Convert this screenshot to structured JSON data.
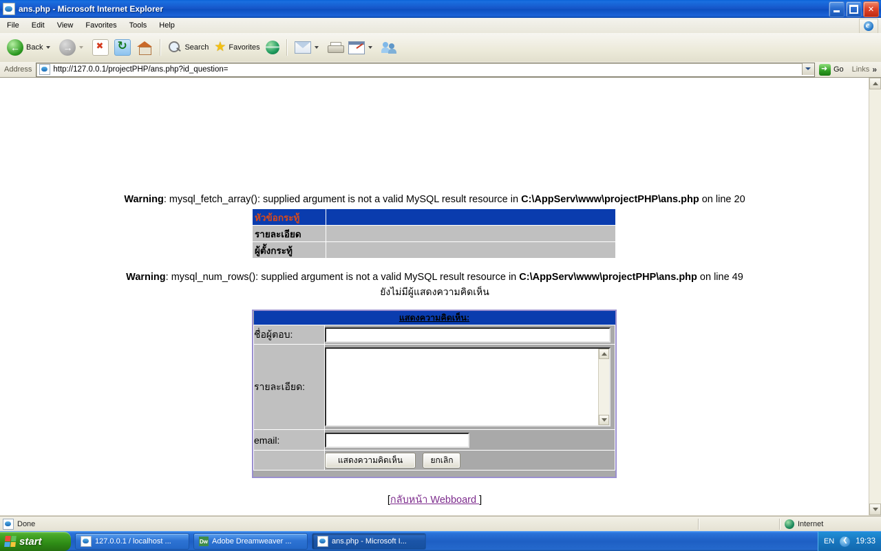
{
  "window": {
    "title": "ans.php - Microsoft Internet Explorer",
    "icon": "page-icon",
    "minimize_label": "Minimize",
    "restore_label": "Restore",
    "close_label": "Close"
  },
  "menubar": {
    "items": [
      "File",
      "Edit",
      "View",
      "Favorites",
      "Tools",
      "Help"
    ]
  },
  "toolbar": {
    "back_label": "Back",
    "forward_label": "",
    "stop_label": "",
    "refresh_label": "",
    "home_label": "",
    "search_label": "Search",
    "favorites_label": "Favorites",
    "history_label": "",
    "mail_label": "",
    "print_label": "",
    "edit_label": "",
    "messenger_label": ""
  },
  "address": {
    "label": "Address",
    "url": "http://127.0.0.1/projectPHP/ans.php?id_question=",
    "go_label": "Go",
    "links_label": "Links",
    "links_chevron": "»"
  },
  "page": {
    "warning1": {
      "prefix": "Warning",
      "colon": ": ",
      "message": "mysql_fetch_array(): supplied argument is not a valid MySQL result resource in ",
      "path": "C:\\AppServ\\www\\projectPHP\\ans.php",
      "suffix": " on line 20"
    },
    "warning2": {
      "prefix": "Warning",
      "colon": ": ",
      "message": "mysql_num_rows(): supplied argument is not a valid MySQL result resource in ",
      "path": "C:\\AppServ\\www\\projectPHP\\ans.php",
      "suffix": " on line 49"
    },
    "no_comments_text": "ยังไม่มีผู้แสดงความคิดเห็น",
    "info_table": {
      "rows": [
        {
          "label": "หัวข้อกระทู้",
          "value": "",
          "highlight": true
        },
        {
          "label": "รายละเอียด",
          "value": "",
          "highlight": false
        },
        {
          "label": "ผู้ตั้งกระทู้",
          "value": "",
          "highlight": false
        }
      ]
    },
    "comment_form": {
      "header": "แสดงความคิดเห็น:",
      "name_label": "ชื่อผู้ตอบ:",
      "name_value": "",
      "detail_label": "รายละเอียด:",
      "detail_value": "",
      "email_label": "email:",
      "email_value": "",
      "submit_label": "แสดงความคิดเห็น",
      "cancel_label": "ยกเลิก"
    },
    "back_link": {
      "open_bracket": "[",
      "text": "กลับหน้า Webboard ",
      "close_bracket": "]"
    }
  },
  "statusbar": {
    "status_text": "Done",
    "zone_text": "Internet"
  },
  "taskbar": {
    "start_label": "start",
    "buttons": [
      {
        "label": "127.0.0.1 / localhost ...",
        "icon": "ie-icon",
        "active": false
      },
      {
        "label": "Adobe Dreamweaver ...",
        "icon": "dreamweaver-icon",
        "active": false
      },
      {
        "label": "ans.php - Microsoft I...",
        "icon": "ie-icon",
        "active": true
      }
    ],
    "language": "EN",
    "clock": "19:33"
  },
  "colors": {
    "titlebar_blue": "#1655c8",
    "table_header_blue": "#0a3cae",
    "table_cell_gray": "#c0c0c0",
    "highlight_red_text": "#d94a1a",
    "form_border_purple": "#9a8fd0",
    "link_purple": "#7c2a8c",
    "form_bg_gray": "#a9a9a9"
  }
}
